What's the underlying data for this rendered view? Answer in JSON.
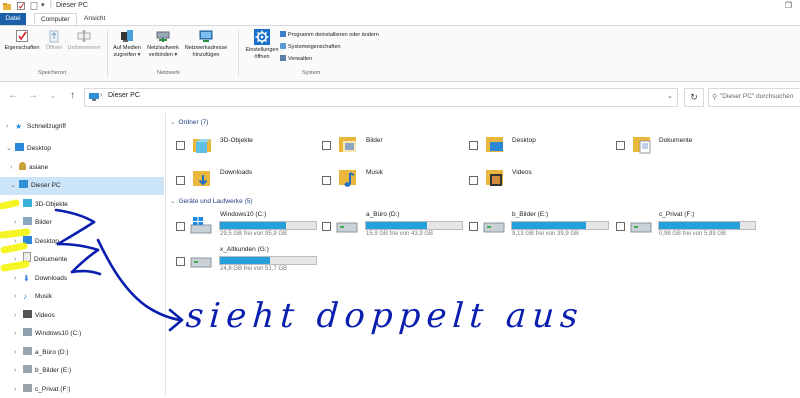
{
  "window": {
    "title": "Dieser PC"
  },
  "tabs": {
    "datei": "Datei",
    "computer": "Computer",
    "ansicht": "Ansicht"
  },
  "ribbon": {
    "eigenschaften": "Eigenschaften",
    "oeffnen": "Öffnen",
    "umbenennen": "Umbenennen",
    "speicherort": "Speicherort",
    "auf_medien_1": "Auf Medien",
    "auf_medien_2": "zugreifen ▾",
    "netzlaufwerk_1": "Netzlaufwerk",
    "netzlaufwerk_2": "verbinden ▾",
    "netzwerkadresse_1": "Netzwerkadresse",
    "netzwerkadresse_2": "hinzufügen",
    "netzwerk": "Netzwerk",
    "einstellungen_1": "Einstellungen",
    "einstellungen_2": "öffnen",
    "programm": "Programm deinstallieren oder ändern",
    "systemeigenschaften": "Systemeigenschaften",
    "verwalten": "Verwalten",
    "system": "System"
  },
  "address": {
    "crumb": "Dieser PC",
    "search_placeholder": "\"Dieser PC\" durchsuchen"
  },
  "nav": {
    "schnellzugriff": "Schnellzugriff",
    "desktop_root": "Desktop",
    "asiane": "asiane",
    "dieser_pc": "Dieser PC",
    "objekte": "3D-Objekte",
    "bilder": "Bilder",
    "desktop": "Desktop",
    "dokumente": "Dokumente",
    "downloads": "Downloads",
    "musik": "Musik",
    "videos": "Videos",
    "windows10": "Windows10 (C:)",
    "a_buero": "a_Büro (D:)",
    "b_bilder": "b_Bilder (E:)",
    "c_privat": "c_Privat (F:)"
  },
  "content": {
    "ordner_header": "Ordner (7)",
    "geraete_header": "Geräte und Laufwerke (5)",
    "folders": [
      "3D-Objekte",
      "Bilder",
      "Desktop",
      "Dokumente",
      "Downloads",
      "Musik",
      "Videos"
    ],
    "drives": [
      {
        "name": "Windows10 (C:)",
        "info": "29,5 GB frei von 95,9 GB",
        "used_fraction": 0.69
      },
      {
        "name": "a_Büro (D:)",
        "info": "15,9 GB frei von 43,9 GB",
        "used_fraction": 0.64
      },
      {
        "name": "b_Bilder (E:)",
        "info": "9,13 GB frei von 39,9 GB",
        "used_fraction": 0.77
      },
      {
        "name": "c_Privat (F:)",
        "info": "0,98 GB frei von 5,99 GB",
        "used_fraction": 0.84
      },
      {
        "name": "x_Altkunden (G:)",
        "info": "24,8 GB frei von 51,7 GB",
        "used_fraction": 0.52
      }
    ]
  },
  "annotation": {
    "text": "sieht doppelt aus"
  },
  "colors": {
    "accent": "#1a5fa8",
    "selection": "#cce4f7",
    "drive_bar": "#26a0da",
    "highlighter": "#f7f700",
    "ink": "#0a1fb0"
  }
}
